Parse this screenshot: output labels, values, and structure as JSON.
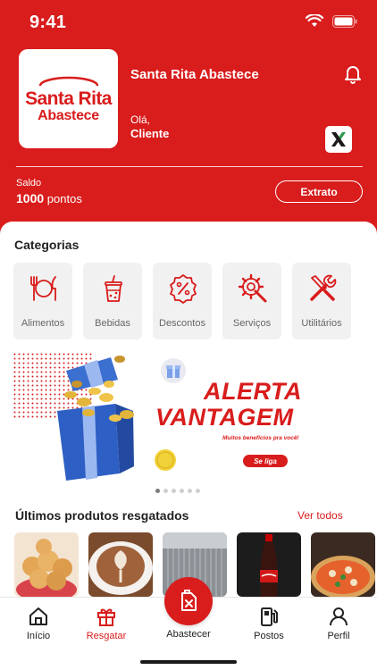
{
  "status_bar": {
    "time": "9:41"
  },
  "header": {
    "logo_line1": "Santa Rita",
    "logo_line2": "Abastece",
    "brand_name": "Santa Rita Abastece",
    "greeting": "Olá,",
    "user_name": "Cliente",
    "saldo_label": "Saldo",
    "saldo_value": "1000",
    "saldo_unit": "pontos",
    "extrato_label": "Extrato"
  },
  "categories": {
    "title": "Categorias",
    "items": [
      {
        "label": "Alimentos",
        "icon": "cutlery-icon"
      },
      {
        "label": "Bebidas",
        "icon": "drink-cup-icon"
      },
      {
        "label": "Descontos",
        "icon": "discount-badge-icon"
      },
      {
        "label": "Serviços",
        "icon": "gear-wrench-icon"
      },
      {
        "label": "Utilitários",
        "icon": "tools-icon"
      }
    ]
  },
  "banner": {
    "line1": "ALERTA",
    "line2": "VANTAGEM",
    "subtitle": "Muitos benefícios pra você!",
    "cta": "Se liga",
    "slides": 6,
    "active_slide": 0
  },
  "recent_products": {
    "title": "Últimos produtos resgatados",
    "see_all": "Ver todos",
    "items": [
      "cheese-bread-image",
      "coffee-image",
      "shower-image",
      "coca-cola-image",
      "pizza-image"
    ]
  },
  "bottom_nav": {
    "items": [
      {
        "label": "Início",
        "icon": "home-icon"
      },
      {
        "label": "Resgatar",
        "icon": "gift-icon",
        "active": true
      },
      {
        "label": "Abastecer",
        "icon": "fuel-can-icon"
      },
      {
        "label": "Postos",
        "icon": "fuel-pump-icon"
      },
      {
        "label": "Perfil",
        "icon": "user-icon"
      }
    ]
  },
  "colors": {
    "brand_red": "#d91c1c",
    "card_gray": "#f1f1f1",
    "text_dark": "#222222"
  }
}
